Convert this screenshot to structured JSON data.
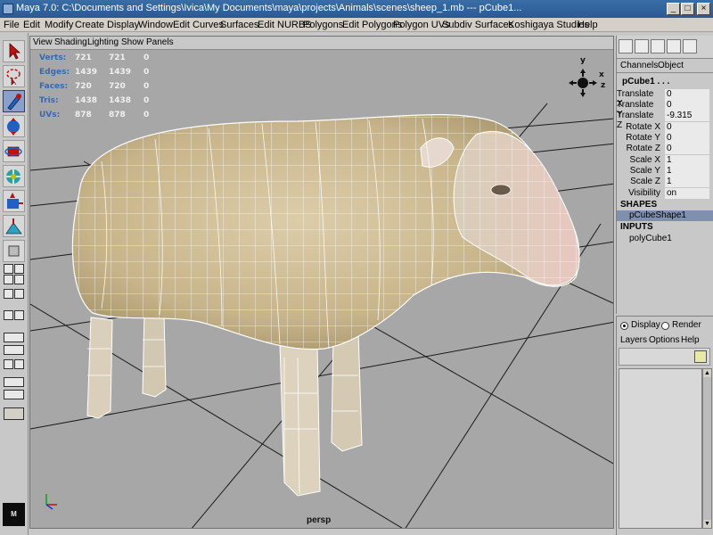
{
  "window": {
    "title": "Maya 7.0: C:\\Documents and Settings\\Ivica\\My Documents\\maya\\projects\\Animals\\scenes\\sheep_1.mb  ---  pCube1...",
    "minimize": "_",
    "maximize": "□",
    "close": "×"
  },
  "menubar": [
    "File",
    "Edit",
    "Modify",
    "Create",
    "Display",
    "Window",
    "Edit Curves",
    "Surfaces",
    "Edit NURBS",
    "Polygons",
    "Edit Polygons",
    "Polygon UVs",
    "Subdiv Surfaces",
    "Koshigaya Studios",
    "Help"
  ],
  "viewport": {
    "menu": [
      "View",
      "Shading",
      "Lighting",
      "Show",
      "Panels"
    ],
    "camera_label": "persp",
    "hud": [
      {
        "label": "Verts:",
        "v1": "721",
        "v2": "721",
        "v3": "0"
      },
      {
        "label": "Edges:",
        "v1": "1439",
        "v2": "1439",
        "v3": "0"
      },
      {
        "label": "Faces:",
        "v1": "720",
        "v2": "720",
        "v3": "0"
      },
      {
        "label": "Tris:",
        "v1": "1438",
        "v2": "1438",
        "v3": "0"
      },
      {
        "label": "UVs:",
        "v1": "878",
        "v2": "878",
        "v3": "0"
      }
    ],
    "axes": {
      "x": "x",
      "y": "y",
      "z": "z"
    },
    "colors": {
      "background": "#a7a7a7",
      "wire": "#ffffff",
      "grid": "#1a1a1a",
      "wool": "#d5c39a"
    }
  },
  "channel_box": {
    "tabs": [
      "Channels",
      "Object"
    ],
    "object_name": "pCube1 . . .",
    "attributes": [
      {
        "name": "Translate X",
        "value": "0"
      },
      {
        "name": "Translate Y",
        "value": "0"
      },
      {
        "name": "Translate Z",
        "value": "-9.315"
      },
      {
        "name": "Rotate X",
        "value": "0"
      },
      {
        "name": "Rotate Y",
        "value": "0"
      },
      {
        "name": "Rotate Z",
        "value": "0"
      },
      {
        "name": "Scale X",
        "value": "1"
      },
      {
        "name": "Scale Y",
        "value": "1"
      },
      {
        "name": "Scale Z",
        "value": "1"
      },
      {
        "name": "Visibility",
        "value": "on"
      }
    ],
    "shapes_header": "SHAPES",
    "shape_name": "pCubeShape1",
    "inputs_header": "INPUTS",
    "input_name": "polyCube1"
  },
  "layer_editor": {
    "display_label": "Display",
    "render_label": "Render",
    "menu": [
      "Layers",
      "Options",
      "Help"
    ]
  }
}
